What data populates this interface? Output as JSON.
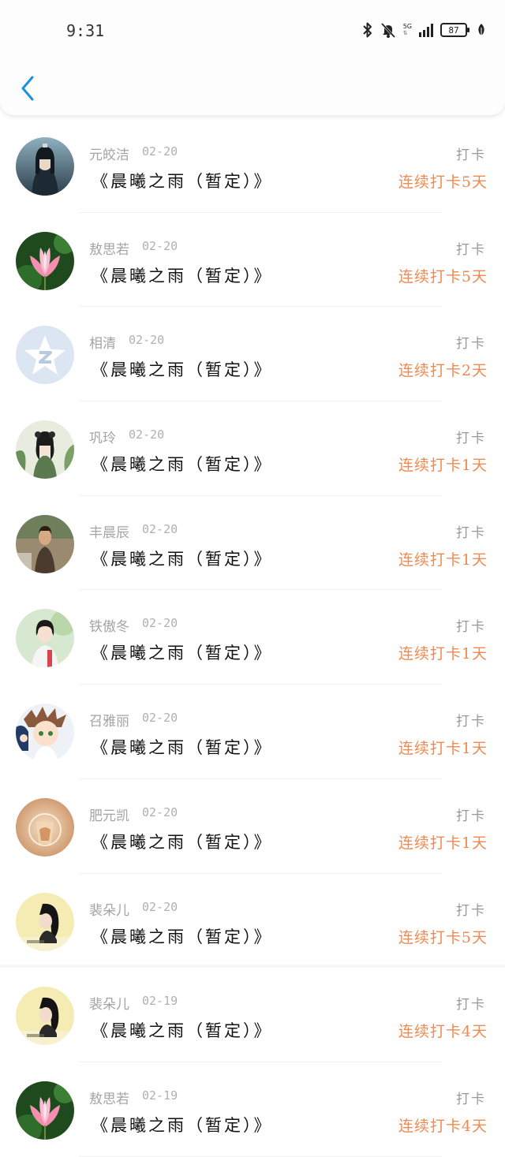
{
  "status_bar": {
    "time": "9:31",
    "network": "5G",
    "battery": "87",
    "icons": [
      "bluetooth-icon",
      "mute-icon",
      "signal-icon",
      "battery-icon",
      "leaf-icon"
    ]
  },
  "header": {
    "back_icon": "chevron-left-icon"
  },
  "colors": {
    "streak": "#ef8a52",
    "back": "#1e8fe0"
  },
  "entries": [
    {
      "name": "元皎洁",
      "date": "02-20",
      "title": "《晨曦之雨（暂定）》",
      "action": "打卡",
      "streak": "连续打卡5天",
      "avatar": "avatar-ink-figure"
    },
    {
      "name": "敖思若",
      "date": "02-20",
      "title": "《晨曦之雨（暂定）》",
      "action": "打卡",
      "streak": "连续打卡5天",
      "avatar": "avatar-lotus"
    },
    {
      "name": "相清",
      "date": "02-20",
      "title": "《晨曦之雨（暂定）》",
      "action": "打卡",
      "streak": "连续打卡2天",
      "avatar": "avatar-qq-default"
    },
    {
      "name": "巩玲",
      "date": "02-20",
      "title": "《晨曦之雨（暂定）》",
      "action": "打卡",
      "streak": "连续打卡1天",
      "avatar": "avatar-painted-lady"
    },
    {
      "name": "丰晨辰",
      "date": "02-20",
      "title": "《晨曦之雨（暂定）》",
      "action": "打卡",
      "streak": "连续打卡1天",
      "avatar": "avatar-man-outdoor"
    },
    {
      "name": "铁傲冬",
      "date": "02-20",
      "title": "《晨曦之雨（暂定）》",
      "action": "打卡",
      "streak": "连续打卡1天",
      "avatar": "avatar-girl-white"
    },
    {
      "name": "召雅丽",
      "date": "02-20",
      "title": "《晨曦之雨（暂定）》",
      "action": "打卡",
      "streak": "连续打卡1天",
      "avatar": "avatar-anime"
    },
    {
      "name": "肥元凯",
      "date": "02-20",
      "title": "《晨曦之雨（暂定）》",
      "action": "打卡",
      "streak": "连续打卡1天",
      "avatar": "avatar-glass-cup"
    },
    {
      "name": "裴朵儿",
      "date": "02-20",
      "title": "《晨曦之雨（暂定）》",
      "action": "打卡",
      "streak": "连续打卡5天",
      "avatar": "avatar-girl-yellow"
    },
    {
      "name": "裴朵儿",
      "date": "02-19",
      "title": "《晨曦之雨（暂定）》",
      "action": "打卡",
      "streak": "连续打卡4天",
      "avatar": "avatar-girl-yellow"
    },
    {
      "name": "敖思若",
      "date": "02-19",
      "title": "《晨曦之雨（暂定）》",
      "action": "打卡",
      "streak": "连续打卡4天",
      "avatar": "avatar-lotus"
    }
  ]
}
